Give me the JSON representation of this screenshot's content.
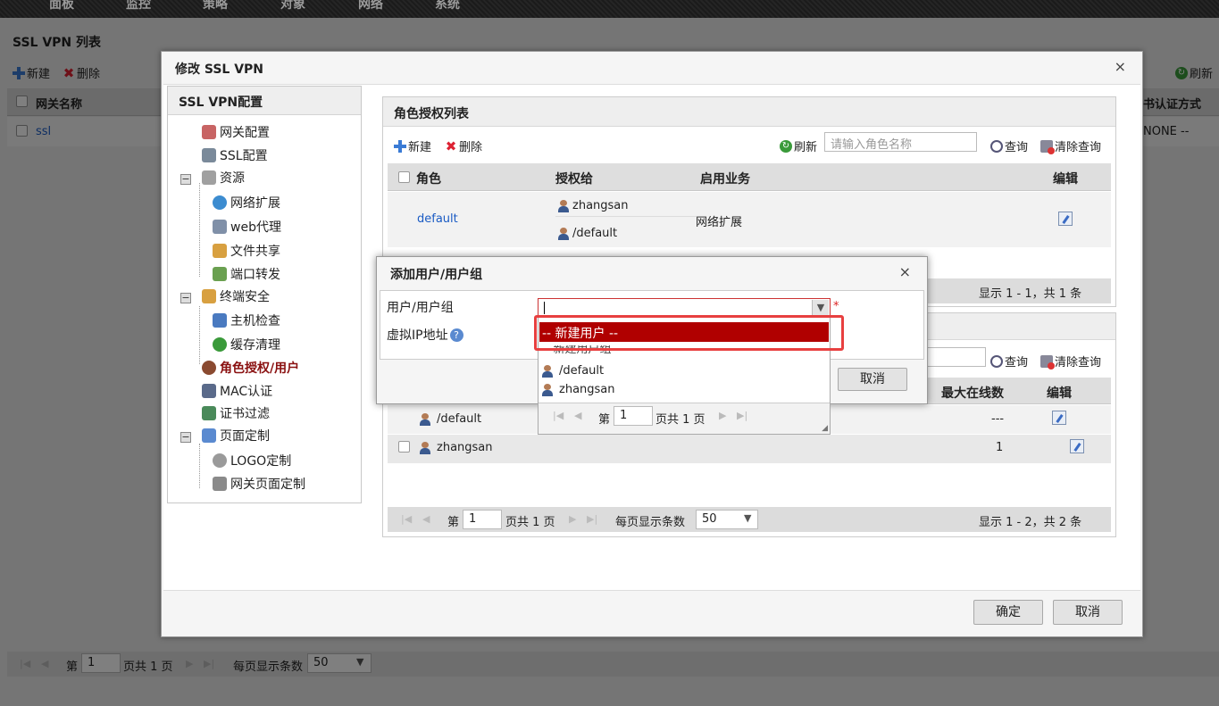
{
  "topnav": [
    "面板",
    "监控",
    "策略",
    "对象",
    "网络",
    "系统"
  ],
  "bg": {
    "title": "SSL VPN 列表",
    "new": "新建",
    "delete": "删除",
    "refresh": "刷新",
    "col_name": "网关名称",
    "col_cert": "书认证方式",
    "row_name": "ssl",
    "row_cert": "NONE --",
    "pager": {
      "page_prefix": "第",
      "page": "1",
      "pages": "页共 1 页",
      "per_page_label": "每页显示条数",
      "per_page": "50"
    }
  },
  "dialog": {
    "title": "修改 SSL VPN",
    "close": "×",
    "ok": "确定",
    "cancel": "取消",
    "tree": {
      "header": "SSL VPN配置",
      "items": [
        {
          "label": "网关配置",
          "color": "#c86464"
        },
        {
          "label": "SSL配置",
          "color": "#7a8a9a"
        },
        {
          "label": "资源",
          "color": "#a0a0a0"
        },
        {
          "label": "网络扩展",
          "color": "#3c8cd0"
        },
        {
          "label": "web代理",
          "color": "#8090a8"
        },
        {
          "label": "文件共享",
          "color": "#d8a040"
        },
        {
          "label": "端口转发",
          "color": "#6aa050"
        },
        {
          "label": "终端安全",
          "color": "#d8a040"
        },
        {
          "label": "主机检查",
          "color": "#4a7ac0"
        },
        {
          "label": "缓存清理",
          "color": "#3a9a3a"
        },
        {
          "label": "角色授权/用户",
          "color": "#8a4a30"
        },
        {
          "label": "MAC认证",
          "color": "#5a6a8a"
        },
        {
          "label": "证书过滤",
          "color": "#4a8a5a"
        },
        {
          "label": "页面定制",
          "color": "#5a8ad0"
        },
        {
          "label": "LOGO定制",
          "color": "#9a9a9a"
        },
        {
          "label": "网关页面定制",
          "color": "#8a8a8a"
        }
      ]
    },
    "role_panel": {
      "title": "角色授权列表",
      "new": "新建",
      "delete": "删除",
      "refresh": "刷新",
      "search_placeholder": "请输入角色名称",
      "query": "查询",
      "clear": "清除查询",
      "col_role": "角色",
      "col_grant": "授权给",
      "col_service": "启用业务",
      "col_edit": "编辑",
      "row": {
        "role": "default",
        "grant1": "zhangsan",
        "grant2": "/default",
        "service": "网络扩展"
      },
      "summary": "显示 1 - 1，共 1 条"
    },
    "user_panel": {
      "query": "查询",
      "clear": "清除查询",
      "col_max": "最大在线数",
      "col_edit": "编辑",
      "rows": [
        {
          "name": "/default",
          "max": "---"
        },
        {
          "name": "zhangsan",
          "max": "1"
        }
      ],
      "pager": {
        "page_prefix": "第",
        "page": "1",
        "pages": "页共 1 页",
        "per_page_label": "每页显示条数",
        "per_page": "50"
      },
      "summary": "显示 1 - 2，共 2 条"
    }
  },
  "subdialog": {
    "title": "添加用户/用户组",
    "close": "×",
    "label_user": "用户/用户组",
    "label_ip": "虚拟IP地址",
    "required": "*",
    "cancel": "取消"
  },
  "dropdown": {
    "selected": "-- 新建用户 --",
    "option2": "-- 新建用户组 --",
    "option3": "/default",
    "option4": "zhangsan",
    "pager": {
      "page_prefix": "第",
      "page": "1",
      "pages": "页共 1 页"
    }
  },
  "colors": {
    "accent_red": "#b00000",
    "highlight": "#e84040",
    "link": "#1a5bc4"
  }
}
